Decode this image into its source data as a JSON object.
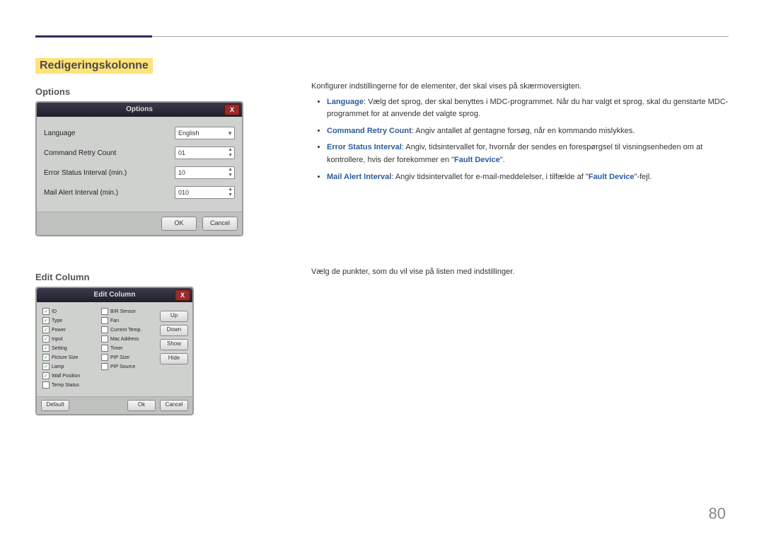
{
  "section_title": "Redigeringskolonne",
  "page_number": "80",
  "options": {
    "heading": "Options",
    "dialog_title": "Options",
    "close_label": "X",
    "rows": {
      "language_label": "Language",
      "language_value": "English",
      "retry_label": "Command Retry Count",
      "retry_value": "01",
      "error_label": "Error Status Interval (min.)",
      "error_value": "10",
      "mail_label": "Mail Alert Interval (min.)",
      "mail_value": "010"
    },
    "ok": "OK",
    "cancel": "Cancel",
    "intro": "Konfigurer indstillingerne for de elementer, der skal vises på skærmoversigten.",
    "bullets": {
      "b1_bold": "Language",
      "b1_rest": ": Vælg det sprog, der skal benyttes i MDC-programmet. Når du har valgt et sprog, skal du genstarte MDC-programmet for at anvende det valgte sprog.",
      "b2_bold": "Command Retry Count",
      "b2_rest": ": Angiv antallet af gentagne forsøg, når en kommando mislykkes.",
      "b3_bold": "Error Status Interval",
      "b3_rest_a": ": Angiv, tidsintervallet for, hvornår der sendes en forespørgsel til visningsenheden om at kontrollere, hvis der forekommer en \"",
      "b3_fault": "Fault Device",
      "b3_rest_b": "\".",
      "b4_bold": "Mail Alert Interval",
      "b4_rest_a": ": Angiv tidsintervallet for e-mail-meddelelser, i tilfælde af \"",
      "b4_fault": "Fault Device",
      "b4_rest_b": "\"-fejl."
    }
  },
  "edit_column": {
    "heading": "Edit Column",
    "dialog_title": "Edit Column",
    "close_label": "X",
    "desc": "Vælg de punkter, som du vil vise på listen med indstillinger.",
    "left_items": [
      {
        "label": "ID",
        "checked": true
      },
      {
        "label": "Type",
        "checked": true
      },
      {
        "label": "Power",
        "checked": true
      },
      {
        "label": "Input",
        "checked": true
      },
      {
        "label": "Setting",
        "checked": true
      },
      {
        "label": "Picture Size",
        "checked": true
      },
      {
        "label": "Lamp",
        "checked": true
      },
      {
        "label": "Wall Position",
        "checked": true
      },
      {
        "label": "Temp Status",
        "checked": false
      }
    ],
    "right_items": [
      {
        "label": "B/R Sensor",
        "checked": false
      },
      {
        "label": "Fan",
        "checked": false
      },
      {
        "label": "Current Temp.",
        "checked": false
      },
      {
        "label": "Mac Address",
        "checked": false
      },
      {
        "label": "Timer",
        "checked": false
      },
      {
        "label": "PIP Size",
        "checked": false
      },
      {
        "label": "PIP Source",
        "checked": false
      }
    ],
    "side_buttons": [
      "Up",
      "Down",
      "Show",
      "Hide"
    ],
    "default": "Default",
    "ok": "Ok",
    "cancel": "Cancel"
  }
}
